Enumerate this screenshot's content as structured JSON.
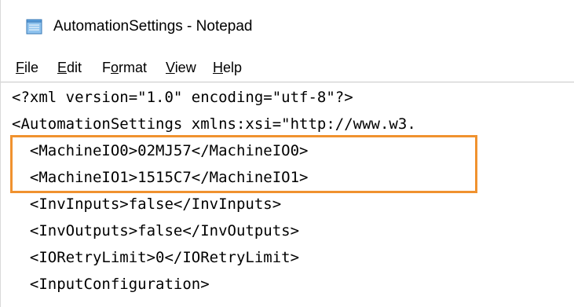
{
  "window": {
    "title": "AutomationSettings - Notepad",
    "icon": "notepad-icon"
  },
  "menu": {
    "file": {
      "accel": "F",
      "rest": "ile"
    },
    "edit": {
      "accel": "E",
      "rest": "dit"
    },
    "format": {
      "pre": "F",
      "accel": "o",
      "rest": "rmat"
    },
    "view": {
      "accel": "V",
      "rest": "iew"
    },
    "help": {
      "accel": "H",
      "rest": "elp"
    }
  },
  "editor": {
    "lines": [
      "<?xml version=\"1.0\" encoding=\"utf-8\"?>",
      "<AutomationSettings xmlns:xsi=\"http://www.w3.",
      "  <MachineIO0>02MJ57</MachineIO0>",
      "  <MachineIO1>1515C7</MachineIO1>",
      "  <InvInputs>false</InvInputs>",
      "  <InvOutputs>false</InvOutputs>",
      "  <IORetryLimit>0</IORetryLimit>",
      "  <InputConfiguration>"
    ]
  },
  "annotation": {
    "highlight_color": "#f0922f"
  }
}
